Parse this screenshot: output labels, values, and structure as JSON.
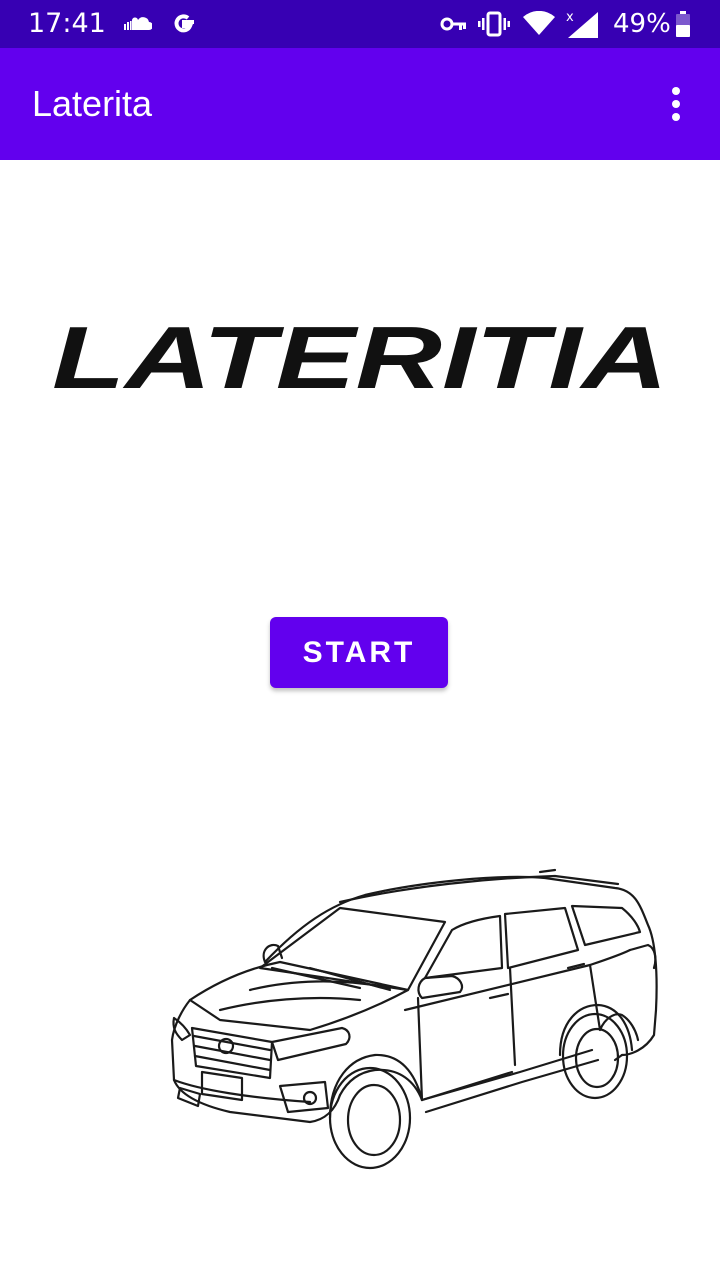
{
  "status_bar": {
    "time": "17:41",
    "battery_percent": "49%",
    "icons": [
      "soundcloud-icon",
      "google-g-icon",
      "vpn-key-icon",
      "vibrate-icon",
      "wifi-icon",
      "signal-icon",
      "battery-icon"
    ]
  },
  "app_bar": {
    "title": "Laterita",
    "menu_icon": "overflow-menu-icon"
  },
  "logo": {
    "text": "LATERITIA"
  },
  "start_button": {
    "label": "START"
  },
  "colors": {
    "status_bar": "#3700b3",
    "primary": "#6200ee",
    "background": "#ffffff",
    "logo": "#111111"
  }
}
